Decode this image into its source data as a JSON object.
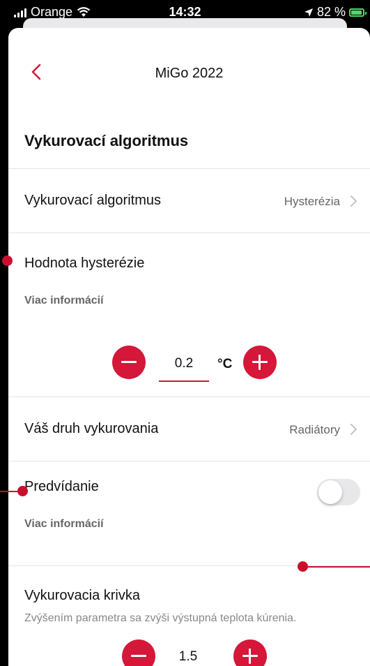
{
  "status_bar": {
    "carrier": "Orange",
    "time": "14:32",
    "battery": "82 %",
    "battery_level": 0.82
  },
  "nav": {
    "title": "MiGo 2022"
  },
  "section": {
    "title": "Vykurovací algoritmus"
  },
  "algorithm_row": {
    "label": "Vykurovací algoritmus",
    "value": "Hysterézia"
  },
  "hysteresis": {
    "label": "Hodnota hysterézie",
    "info": "Viac informácií",
    "value": "0.2",
    "unit": "°C"
  },
  "heating_type_row": {
    "label": "Váš druh vykurovania",
    "value": "Radiátory"
  },
  "prediction": {
    "label": "Predvídanie",
    "info": "Viac informácií",
    "enabled": false
  },
  "curve": {
    "label": "Vykurovacia krivka",
    "description": "Zvýšením parametra sa zvýši výstupná teplota kúrenia.",
    "value": "1.5"
  },
  "colors": {
    "accent": "#d5173a",
    "annotation": "#c8102e"
  }
}
